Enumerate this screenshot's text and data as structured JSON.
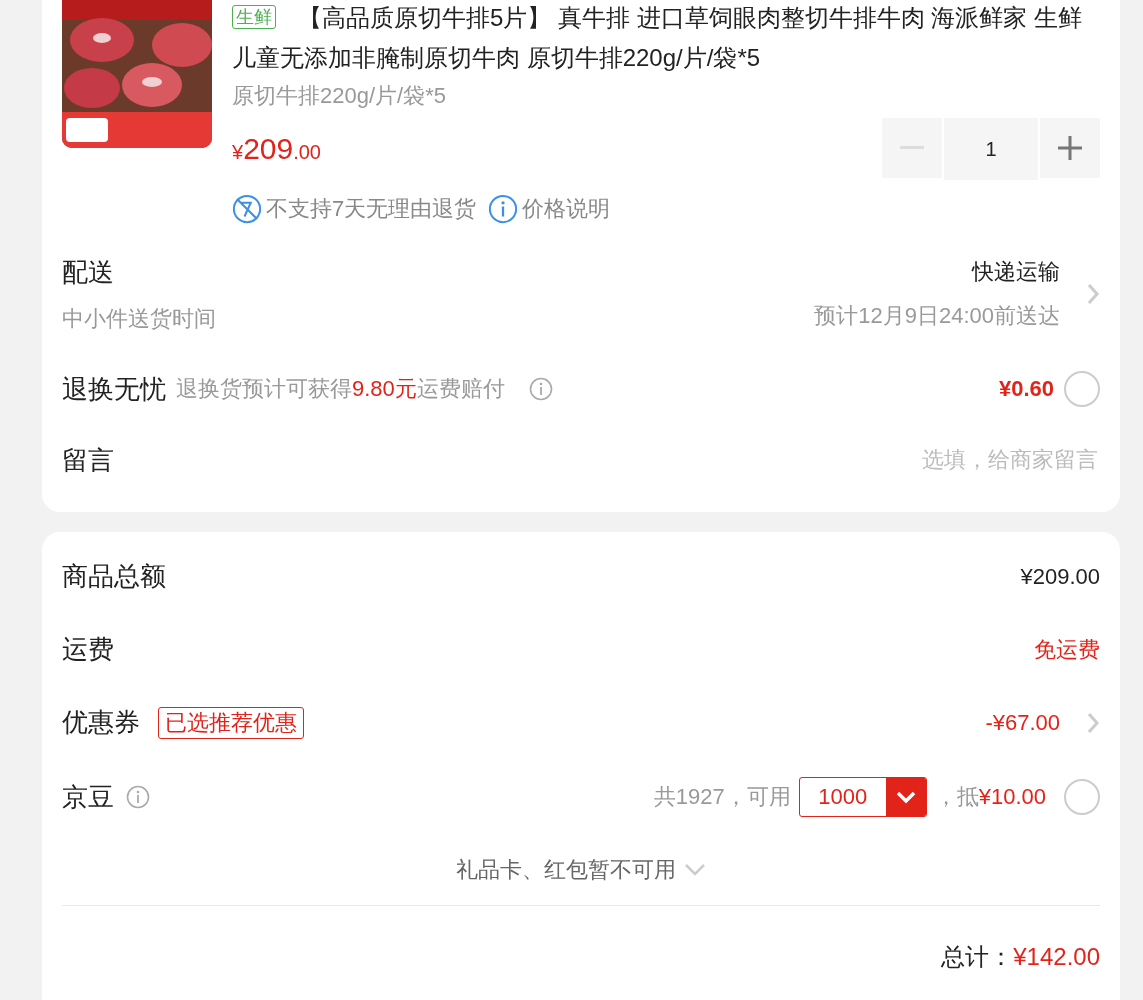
{
  "product": {
    "tag": "生鲜",
    "title": "【高品质原切牛排5片】 真牛排 进口草饲眼肉整切牛排牛肉 海派鲜家 生鲜儿童无添加非腌制原切牛肉 原切牛排220g/片/袋*5",
    "spec": "原切牛排220g/片/袋*5",
    "price": {
      "symbol": "¥",
      "integer": "209",
      "decimal": ".00"
    },
    "quantity": {
      "value": "1",
      "minus_disabled": true
    },
    "notices": [
      {
        "kind": "no-return",
        "text": "不支持7天无理由退货"
      },
      {
        "kind": "info",
        "text": "价格说明"
      }
    ]
  },
  "delivery": {
    "label": "配送",
    "method": "快递运输",
    "sub_label": "中小件送货时间",
    "eta": "预计12月9日24:00前送达"
  },
  "return_insurance": {
    "label": "退换无忧",
    "desc_before": "退换货预计可获得",
    "desc_highlight": "9.80元",
    "desc_after": "运费赔付",
    "price": "¥0.60",
    "checked": false
  },
  "message": {
    "label": "留言",
    "placeholder": "选填，给商家留言"
  },
  "summary": [
    {
      "kind": "amount",
      "label": "商品总额",
      "value": "¥209.00",
      "highlight": false
    },
    {
      "kind": "amount",
      "label": "运费",
      "value": "免运费",
      "highlight": true
    },
    {
      "kind": "coupon",
      "label": "优惠券",
      "tag": "已选推荐优惠",
      "value": "-¥67.00",
      "highlight": true
    }
  ],
  "beans": {
    "label": "京豆",
    "total": "共1927，可用",
    "select_value": "1000",
    "deduct_label": "，抵",
    "deduct_value": "¥10.00",
    "checked": false
  },
  "gift_cards": {
    "text": "礼品卡、红包暂不可用",
    "expanded": false
  },
  "total": {
    "label": "总计：",
    "value": "¥142.00"
  }
}
